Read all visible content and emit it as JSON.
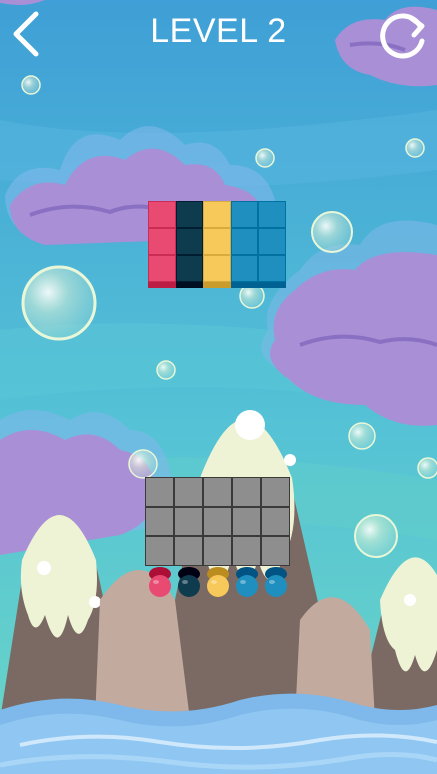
{
  "header": {
    "title": "LEVEL 2",
    "back_icon": "chevron-left-icon",
    "restart_icon": "restart-icon"
  },
  "colors": {
    "sky_top": "#3f9fd6",
    "sky_bottom": "#6ad6c6",
    "cloud": "#a98fd6",
    "mountain": "#7a6a63",
    "snow": "#eef3d6",
    "water": "#8fc6f2",
    "grid_cell": "#8e8e8e"
  },
  "target_pattern": {
    "rows": 3,
    "columns": 5,
    "column_colors": [
      "#e84a72",
      "#0f3b4f",
      "#f7c85a",
      "#1f8fbf",
      "#1f8fbf"
    ]
  },
  "board": {
    "rows": 3,
    "columns": 5,
    "filled": 0
  },
  "pieces": [
    {
      "color": "#e84a72"
    },
    {
      "color": "#0f3b4f"
    },
    {
      "color": "#f7c85a"
    },
    {
      "color": "#1f8fbf"
    },
    {
      "color": "#1f8fbf"
    }
  ]
}
